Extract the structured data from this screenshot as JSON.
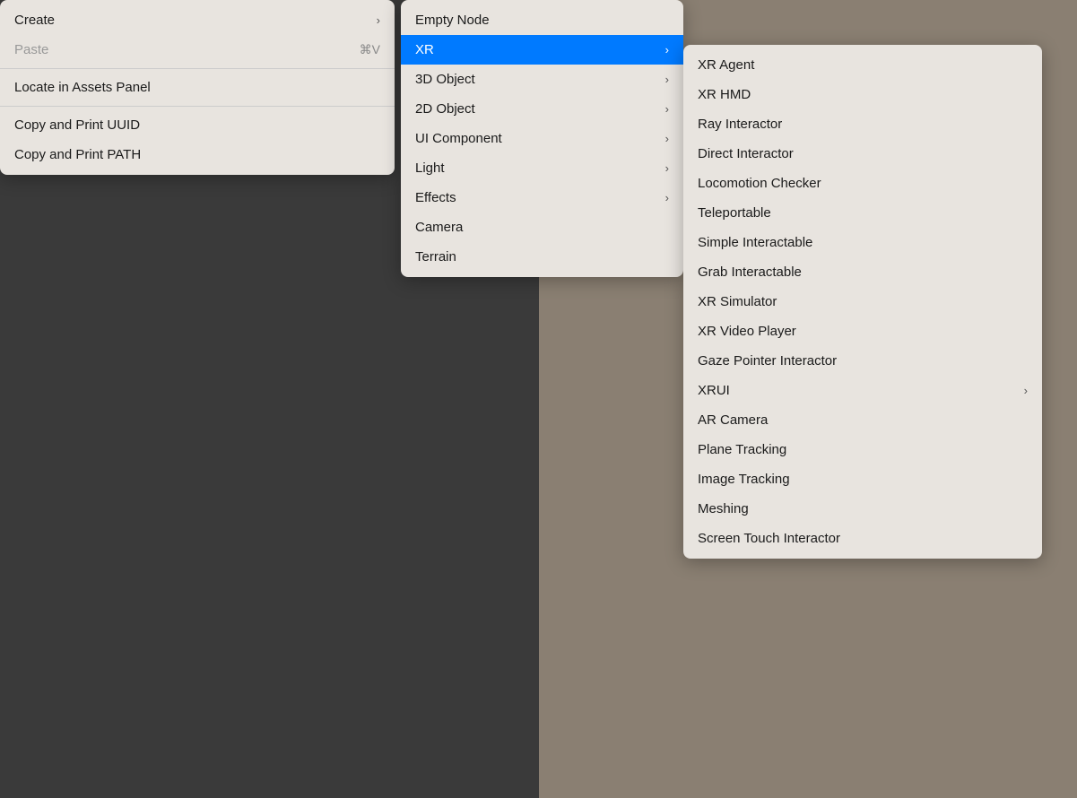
{
  "background": {
    "left_color": "#3a3a3a",
    "right_color": "#8a7f72"
  },
  "menu_create": {
    "items": [
      {
        "id": "create",
        "label": "Create",
        "has_arrow": true,
        "shortcut": "",
        "disabled": false,
        "separator_after": false
      },
      {
        "id": "paste",
        "label": "Paste",
        "has_arrow": false,
        "shortcut": "⌘V",
        "disabled": true,
        "separator_after": true
      },
      {
        "id": "locate-assets",
        "label": "Locate in Assets Panel",
        "has_arrow": false,
        "shortcut": "",
        "disabled": false,
        "separator_after": true
      },
      {
        "id": "copy-uuid",
        "label": "Copy and Print UUID",
        "has_arrow": false,
        "shortcut": "",
        "disabled": false,
        "separator_after": false
      },
      {
        "id": "copy-path",
        "label": "Copy and Print PATH",
        "has_arrow": false,
        "shortcut": "",
        "disabled": false,
        "separator_after": false
      }
    ]
  },
  "menu_nodes": {
    "items": [
      {
        "id": "empty-node",
        "label": "Empty Node",
        "has_arrow": false
      },
      {
        "id": "xr",
        "label": "XR",
        "has_arrow": true,
        "active": true
      },
      {
        "id": "3d-object",
        "label": "3D Object",
        "has_arrow": true
      },
      {
        "id": "2d-object",
        "label": "2D Object",
        "has_arrow": true
      },
      {
        "id": "ui-component",
        "label": "UI Component",
        "has_arrow": true
      },
      {
        "id": "light",
        "label": "Light",
        "has_arrow": true
      },
      {
        "id": "effects",
        "label": "Effects",
        "has_arrow": true
      },
      {
        "id": "camera",
        "label": "Camera",
        "has_arrow": false
      },
      {
        "id": "terrain",
        "label": "Terrain",
        "has_arrow": false
      }
    ]
  },
  "menu_xr": {
    "items": [
      {
        "id": "xr-agent",
        "label": "XR Agent",
        "has_arrow": false
      },
      {
        "id": "xr-hmd",
        "label": "XR HMD",
        "has_arrow": false
      },
      {
        "id": "ray-interactor",
        "label": "Ray Interactor",
        "has_arrow": false
      },
      {
        "id": "direct-interactor",
        "label": "Direct Interactor",
        "has_arrow": false
      },
      {
        "id": "locomotion-checker",
        "label": "Locomotion Checker",
        "has_arrow": false
      },
      {
        "id": "teleportable",
        "label": "Teleportable",
        "has_arrow": false
      },
      {
        "id": "simple-interactable",
        "label": "Simple Interactable",
        "has_arrow": false
      },
      {
        "id": "grab-interactable",
        "label": "Grab Interactable",
        "has_arrow": false
      },
      {
        "id": "xr-simulator",
        "label": "XR Simulator",
        "has_arrow": false
      },
      {
        "id": "xr-video-player",
        "label": "XR Video Player",
        "has_arrow": false
      },
      {
        "id": "gaze-pointer-interactor",
        "label": "Gaze Pointer Interactor",
        "has_arrow": false
      },
      {
        "id": "xrui",
        "label": "XRUI",
        "has_arrow": true
      },
      {
        "id": "ar-camera",
        "label": "AR Camera",
        "has_arrow": false
      },
      {
        "id": "plane-tracking",
        "label": "Plane Tracking",
        "has_arrow": false
      },
      {
        "id": "image-tracking",
        "label": "Image Tracking",
        "has_arrow": false
      },
      {
        "id": "meshing",
        "label": "Meshing",
        "has_arrow": false
      },
      {
        "id": "screen-touch-interactor",
        "label": "Screen Touch Interactor",
        "has_arrow": false
      }
    ]
  },
  "icons": {
    "chevron_right": "›",
    "cmd": "⌘"
  }
}
